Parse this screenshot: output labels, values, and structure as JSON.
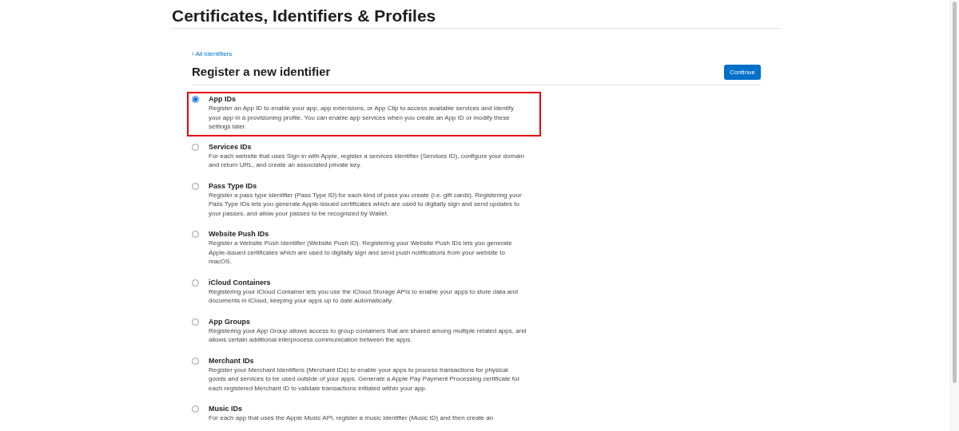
{
  "header": {
    "title": "Certificates, Identifiers & Profiles"
  },
  "back_link": {
    "label": "‹ All Identifiers"
  },
  "heading": "Register a new identifier",
  "continue_button": "Continue",
  "options": [
    {
      "title": "App IDs",
      "selected": true,
      "highlighted": true,
      "description": "Register an App ID to enable your app, app extensions, or App Clip to access available services and identify your app in a provisioning profile. You can enable app services when you create an App ID or modify these settings later."
    },
    {
      "title": "Services IDs",
      "selected": false,
      "highlighted": false,
      "description": "For each website that uses Sign in with Apple, register a services identifier (Services ID), configure your domain and return URL, and create an associated private key."
    },
    {
      "title": "Pass Type IDs",
      "selected": false,
      "highlighted": false,
      "description": "Register a pass type identifier (Pass Type ID) for each kind of pass you create (i.e. gift cards). Registering your Pass Type IDs lets you generate Apple-issued certificates which are used to digitally sign and send updates to your passes, and allow your passes to be recognized by Wallet."
    },
    {
      "title": "Website Push IDs",
      "selected": false,
      "highlighted": false,
      "description": "Register a Website Push Identifier (Website Push ID). Registering your Website Push IDs lets you generate Apple-issued certificates which are used to digitally sign and send push notifications from your website to macOS."
    },
    {
      "title": "iCloud Containers",
      "selected": false,
      "highlighted": false,
      "description": "Registering your iCloud Container lets you use the iCloud Storage APIs to enable your apps to store data and documents in iCloud, keeping your apps up to date automatically."
    },
    {
      "title": "App Groups",
      "selected": false,
      "highlighted": false,
      "description": "Registering your App Group allows access to group containers that are shared among multiple related apps, and allows certain additional interprocess communication between the apps."
    },
    {
      "title": "Merchant IDs",
      "selected": false,
      "highlighted": false,
      "description": "Register your Merchant Identifiers (Merchant IDs) to enable your apps to process transactions for physical goods and services to be used outside of your apps. Generate a Apple Pay Payment Processing certificate for each registered Merchant ID to validate transactions initiated within your app."
    },
    {
      "title": "Music IDs",
      "selected": false,
      "highlighted": false,
      "description": "For each app that uses the Apple Music API, register a music identifier (Music ID) and then create an"
    }
  ]
}
